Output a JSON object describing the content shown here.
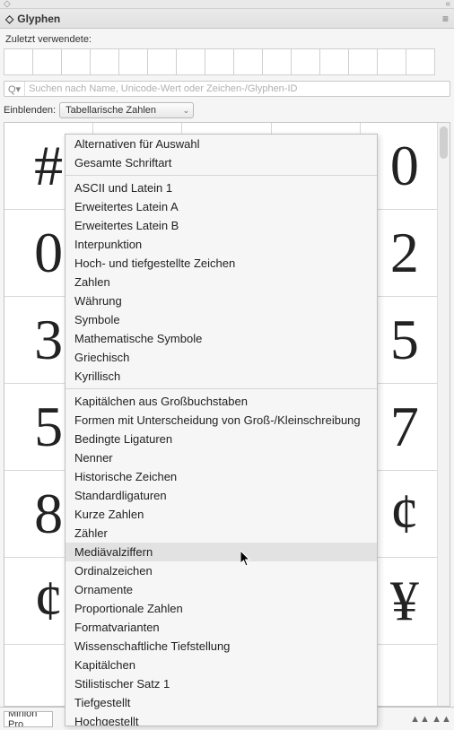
{
  "panel": {
    "title": "Glyphen",
    "collapse_icon": "«",
    "expand_icon": "◇",
    "menu_icon": "≡"
  },
  "recent": {
    "label": "Zuletzt verwendete:"
  },
  "search": {
    "placeholder": "Suchen nach Name, Unicode-Wert oder Zeichen-/Glyphen-ID"
  },
  "filter": {
    "label": "Einblenden:",
    "selected": "Tabellarische Zahlen"
  },
  "glyphs": {
    "rows": [
      [
        "#",
        "",
        "",
        "",
        "0"
      ],
      [
        "0",
        "",
        "",
        "",
        "2"
      ],
      [
        "3",
        "",
        "",
        "",
        "5"
      ],
      [
        "5",
        "",
        "",
        "",
        "7"
      ],
      [
        "8",
        "",
        "",
        "",
        "¢"
      ],
      [
        "¢",
        "",
        "",
        "",
        "¥"
      ],
      [
        "",
        "",
        "",
        "",
        ""
      ]
    ]
  },
  "menu": {
    "highlighted": "Mediävalziffern",
    "groups": [
      [
        "Alternativen für Auswahl",
        "Gesamte Schriftart"
      ],
      [
        "ASCII und Latein 1",
        "Erweitertes Latein A",
        "Erweitertes Latein B",
        "Interpunktion",
        "Hoch- und tiefgestellte Zeichen",
        "Zahlen",
        "Währung",
        "Symbole",
        "Mathematische Symbole",
        "Griechisch",
        "Kyrillisch"
      ],
      [
        "Kapitälchen aus Großbuchstaben",
        "Formen mit Unterscheidung von Groß-/Kleinschreibung",
        "Bedingte Ligaturen",
        "Nenner",
        "Historische Zeichen",
        "Standardligaturen",
        "Kurze Zahlen",
        "Zähler",
        "Mediävalziffern",
        "Ordinalzeichen",
        "Ornamente",
        "Proportionale Zahlen",
        "Formatvarianten",
        "Wissenschaftliche Tiefstellung",
        "Kapitälchen",
        "Stilistischer Satz 1",
        "Tiefgestellt",
        "Hochgestellt"
      ]
    ]
  },
  "footer": {
    "font": "Minion Pro"
  }
}
